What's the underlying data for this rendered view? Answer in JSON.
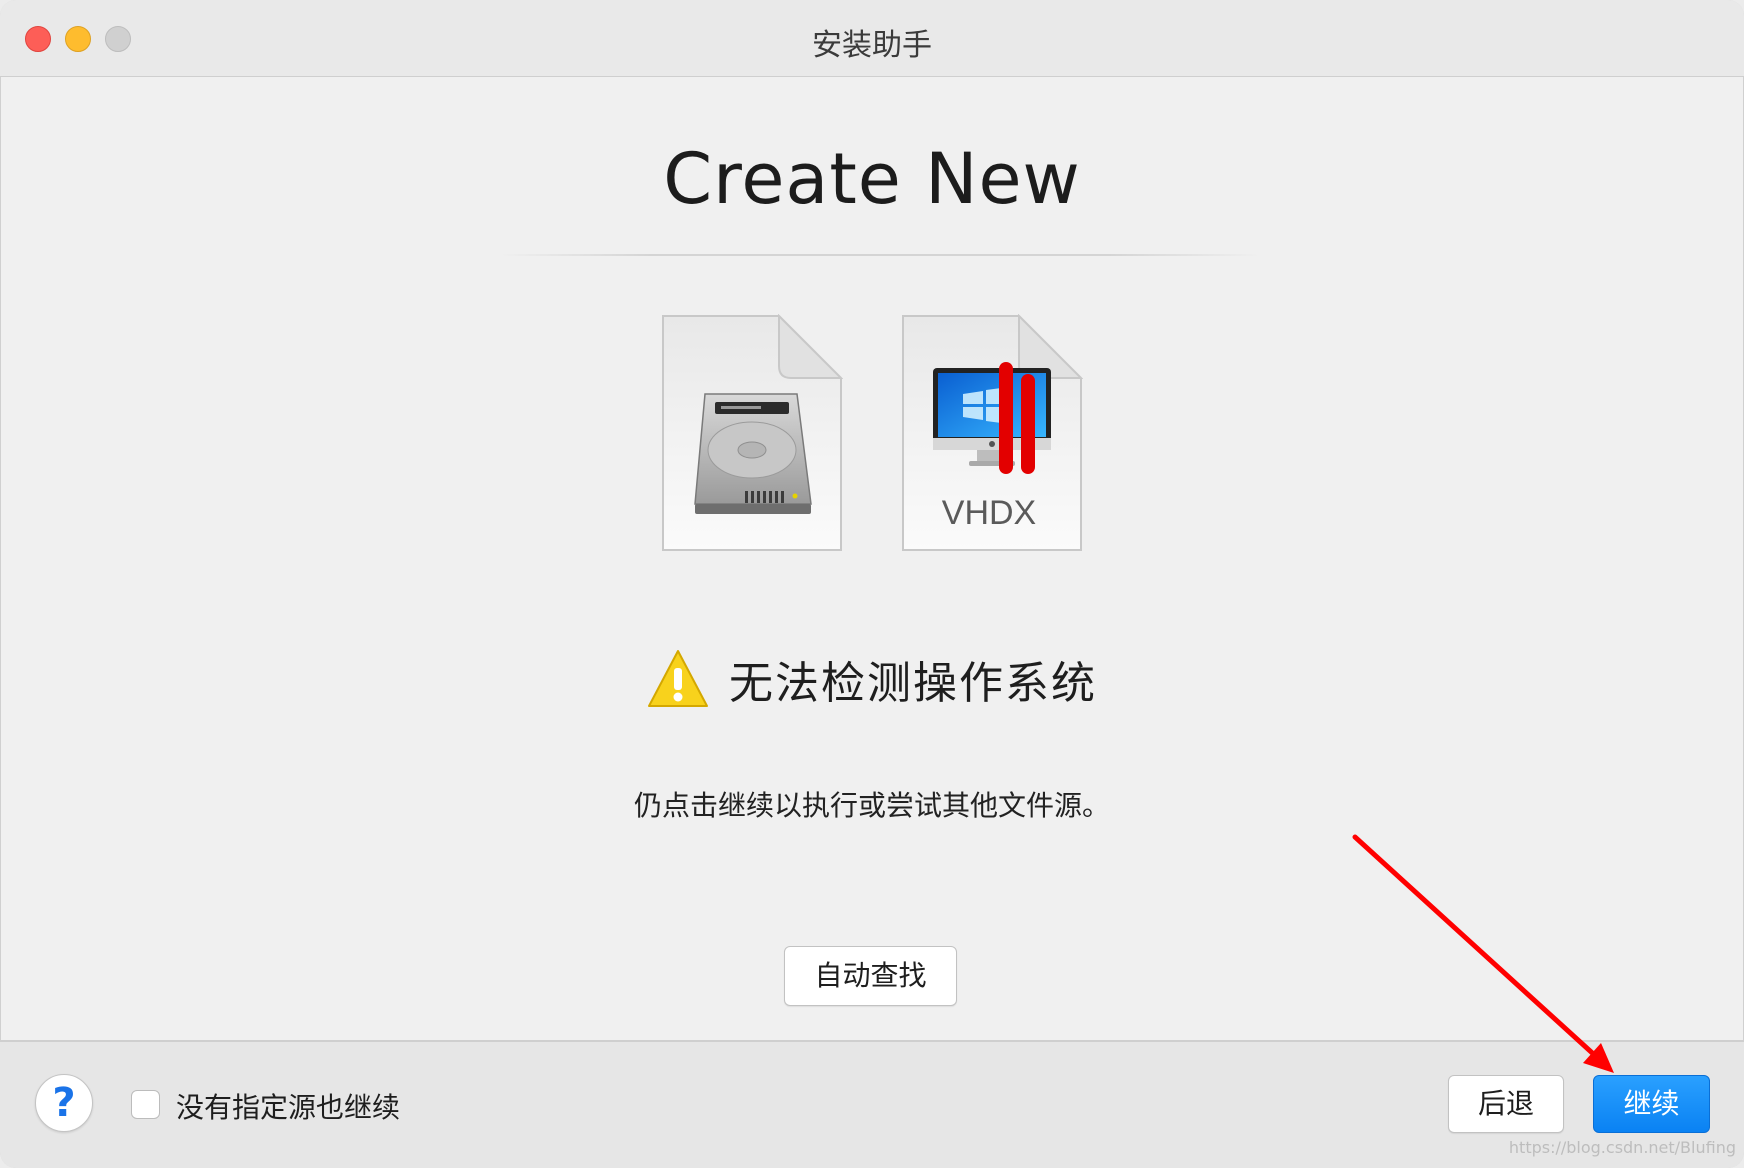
{
  "window": {
    "title": "安装助手"
  },
  "main": {
    "heading": "Create New",
    "files": [
      {
        "icon": "hard-disk-icon"
      },
      {
        "icon": "vhdx-file-icon",
        "label": "VHDX"
      }
    ],
    "warning": {
      "icon": "warning-icon",
      "text": "无法检测操作系统"
    },
    "hint": "仍点击继续以执行或尝试其他文件源。",
    "auto_find_label": "自动查找"
  },
  "footer": {
    "help_label": "?",
    "checkbox_label": "没有指定源也继续",
    "checkbox_checked": false,
    "back_label": "后退",
    "continue_label": "继续"
  },
  "watermark": "https://blog.csdn.net/Blufing",
  "colors": {
    "accent": "#0a82f3",
    "warning": "#f8d21c",
    "annotation": "#ff0000"
  }
}
